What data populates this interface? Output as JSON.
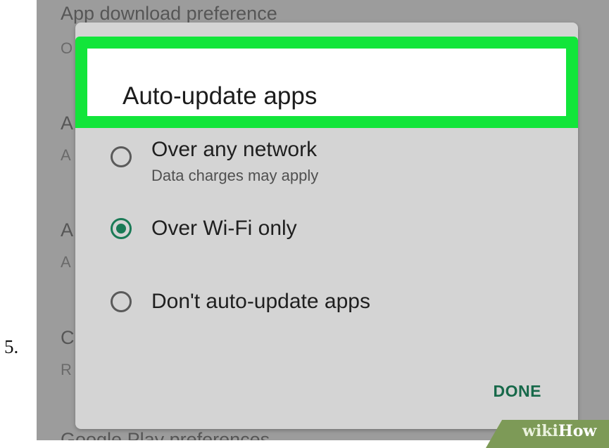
{
  "page": {
    "step_number": "5."
  },
  "background": {
    "items": [
      {
        "title": "App download preference",
        "subtitle": "O"
      },
      {
        "title": "A",
        "subtitle": "A"
      },
      {
        "title": "A",
        "subtitle": "A"
      },
      {
        "title": "C",
        "subtitle": "R"
      },
      {
        "title": "Google Play preferences",
        "subtitle": ""
      }
    ]
  },
  "dialog": {
    "title": "Auto-update apps",
    "options": [
      {
        "label": "Over any network",
        "sublabel": "Data charges may apply",
        "selected": false
      },
      {
        "label": "Over Wi-Fi only",
        "sublabel": "",
        "selected": true
      },
      {
        "label": "Don't auto-update apps",
        "sublabel": "",
        "selected": false
      }
    ],
    "done_label": "DONE"
  },
  "watermark": {
    "wiki": "wiki",
    "how": "How"
  },
  "colors": {
    "highlight": "#12e53a",
    "accent": "#1a7a56"
  }
}
